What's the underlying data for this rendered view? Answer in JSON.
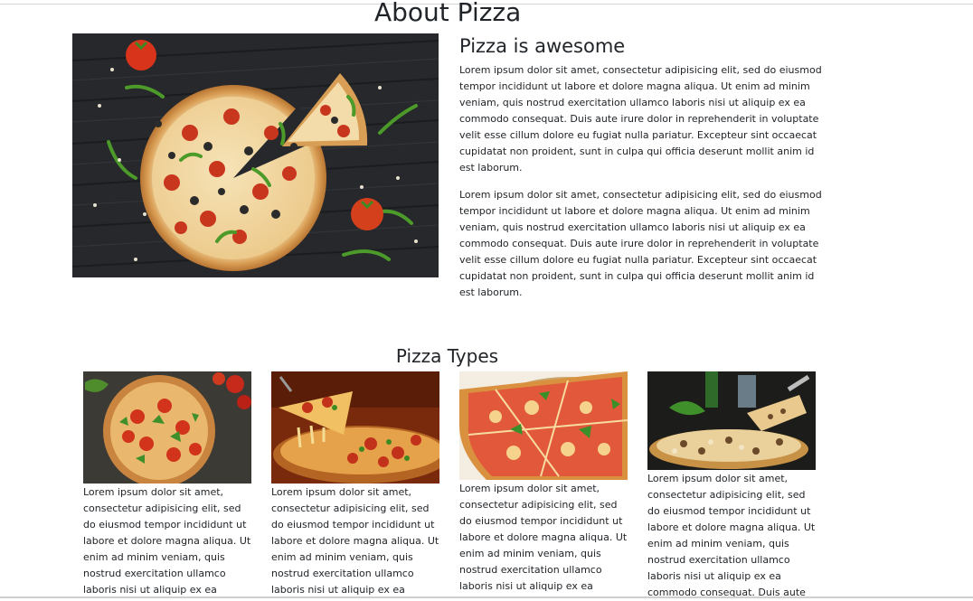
{
  "about": {
    "title": "About Pizza"
  },
  "hero": {
    "image_alt": "pizza-on-dark-wood",
    "heading": "Pizza is awesome",
    "paragraphs": [
      "Lorem ipsum dolor sit amet, consectetur adipisicing elit, sed do eiusmod tempor incididunt ut labore et dolore magna aliqua. Ut enim ad minim veniam, quis nostrud exercitation ullamco laboris nisi ut aliquip ex ea commodo consequat. Duis aute irure dolor in reprehenderit in voluptate velit esse cillum dolore eu fugiat nulla pariatur. Excepteur sint occaecat cupidatat non proident, sunt in culpa qui officia deserunt mollit anim id est laborum.",
      "Lorem ipsum dolor sit amet, consectetur adipisicing elit, sed do eiusmod tempor incididunt ut labore et dolore magna aliqua. Ut enim ad minim veniam, quis nostrud exercitation ullamco laboris nisi ut aliquip ex ea commodo consequat. Duis aute irure dolor in reprehenderit in voluptate velit esse cillum dolore eu fugiat nulla pariatur. Excepteur sint occaecat cupidatat non proident, sunt in culpa qui officia deserunt mollit anim id est laborum."
    ]
  },
  "types": {
    "title": "Pizza Types",
    "cards": [
      {
        "image_alt": "margherita-pizza",
        "text": "Lorem ipsum dolor sit amet, consectetur adipisicing elit, sed do eiusmod tempor incididunt ut labore et dolore magna aliqua. Ut enim ad minim veniam, quis nostrud exercitation ullamco laboris nisi ut aliquip ex ea"
      },
      {
        "image_alt": "cheese-pull-pizza",
        "text": "Lorem ipsum dolor sit amet, consectetur adipisicing elit, sed do eiusmod tempor incididunt ut labore et dolore magna aliqua. Ut enim ad minim veniam, quis nostrud exercitation ullamco laboris nisi ut aliquip ex ea"
      },
      {
        "image_alt": "sliced-pizza",
        "text": "Lorem ipsum dolor sit amet, consectetur adipisicing elit, sed do eiusmod tempor incididunt ut labore et dolore magna aliqua. Ut enim ad minim veniam, quis nostrud exercitation ullamco laboris nisi ut aliquip ex ea"
      },
      {
        "image_alt": "mushroom-pizza-slice",
        "text": "Lorem ipsum dolor sit amet, consectetur adipisicing elit, sed do eiusmod tempor incididunt ut labore et dolore magna aliqua. Ut enim ad minim veniam, quis nostrud exercitation ullamco laboris nisi ut aliquip ex ea commodo consequat. Duis aute"
      }
    ]
  },
  "colors": {
    "text": "#212529",
    "wood": "#2b2d30",
    "crust": "#d9a35a",
    "sauce": "#c8361e"
  }
}
